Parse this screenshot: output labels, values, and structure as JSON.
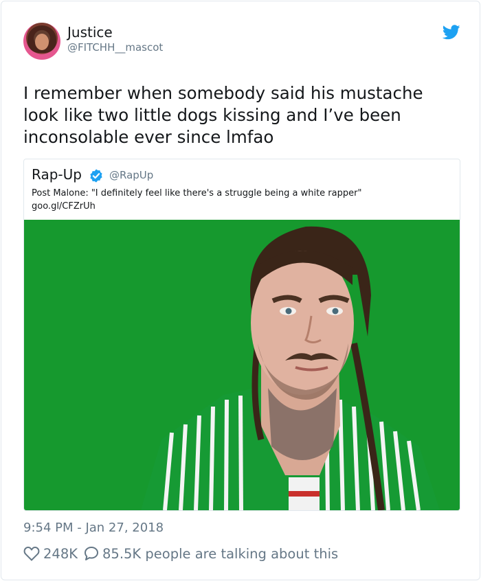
{
  "author": {
    "name": "Justice",
    "handle": "@FITCHH__mascot"
  },
  "tweet": {
    "text": "I remember when somebody said his mustache look like two little dogs kissing and I’ve been inconsolable ever since lmfao",
    "timestamp": "9:54 PM - Jan 27, 2018"
  },
  "quoted": {
    "name": "Rap-Up",
    "handle": "@RapUp",
    "text_line1": "Post Malone: \"I definitely feel like there's a struggle being a white rapper\"",
    "text_line2": "goo.gl/CFZrUh"
  },
  "stats": {
    "likes": "248K",
    "talking": "85.5K people are talking about this"
  },
  "icons": {
    "brand": "twitter-bird-icon",
    "verified": "verified-badge-icon",
    "like": "heart-icon",
    "reply": "speech-bubble-icon"
  },
  "colors": {
    "brand_blue": "#1da1f2",
    "secondary_text": "#657786",
    "photo_background": "#16992e"
  }
}
